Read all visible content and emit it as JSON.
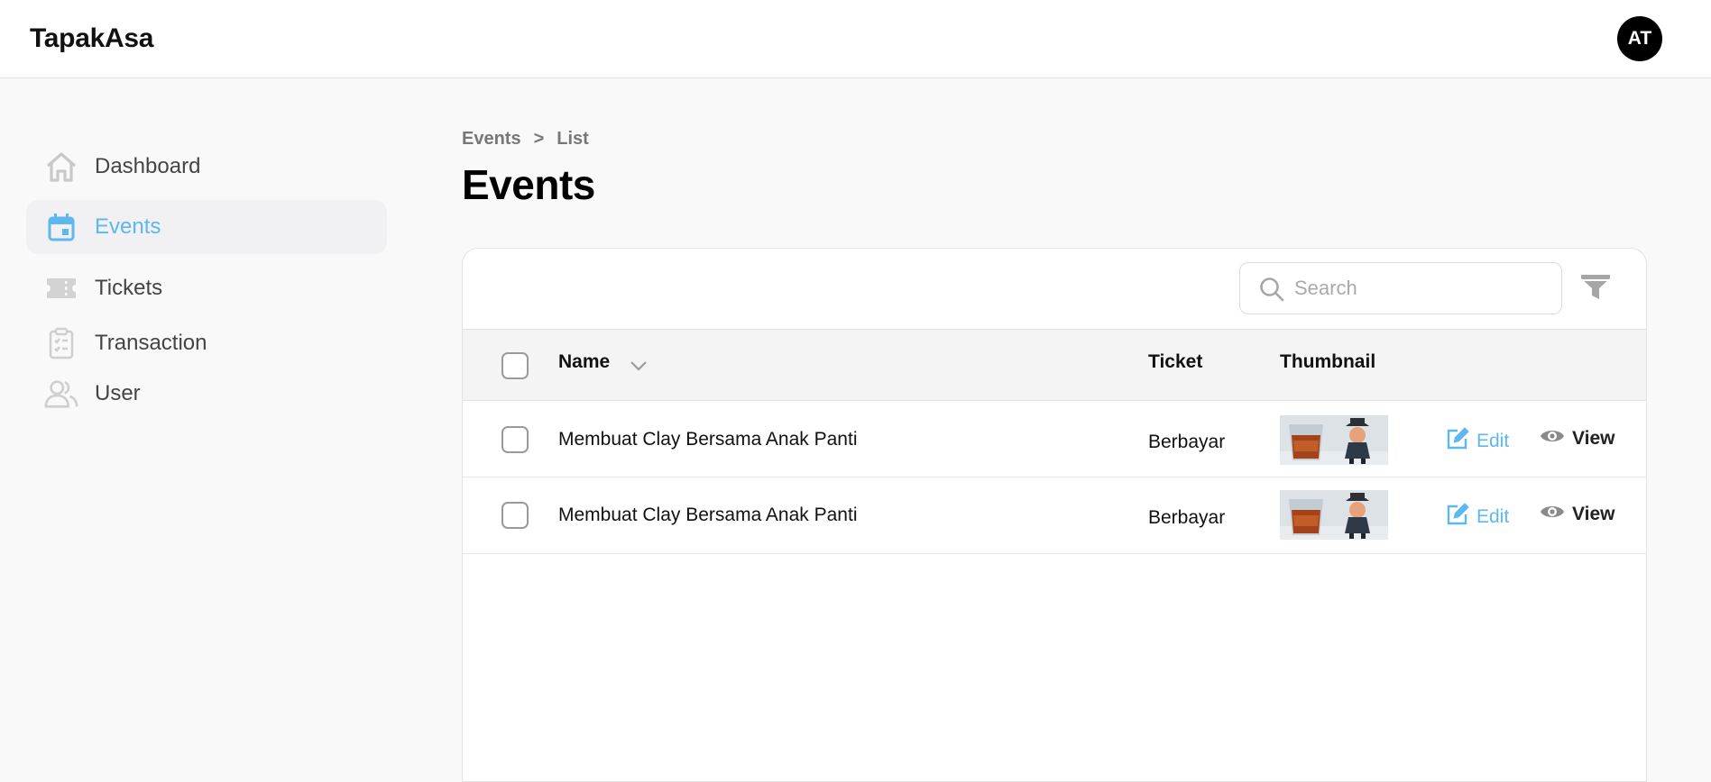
{
  "header": {
    "brand": "TapakAsa",
    "avatar_initials": "AT"
  },
  "sidebar": {
    "items": [
      {
        "label": "Dashboard",
        "icon": "home-icon",
        "active": false
      },
      {
        "label": "Events",
        "icon": "calendar-icon",
        "active": true
      },
      {
        "label": "Tickets",
        "icon": "ticket-icon",
        "active": false
      },
      {
        "label": "Transaction",
        "icon": "clipboard-icon",
        "active": false
      },
      {
        "label": "User",
        "icon": "users-icon",
        "active": false
      }
    ]
  },
  "breadcrumb": {
    "parent": "Events",
    "separator": ">",
    "current": "List"
  },
  "page": {
    "title": "Events"
  },
  "toolbar": {
    "search_placeholder": "Search",
    "search_value": ""
  },
  "table": {
    "columns": {
      "name": "Name",
      "ticket": "Ticket",
      "thumbnail": "Thumbnail"
    },
    "rows": [
      {
        "name": "Membuat Clay Bersama Anak Panti",
        "ticket": "Berbayar",
        "edit_label": "Edit",
        "view_label": "View"
      },
      {
        "name": "Membuat Clay Bersama Anak Panti",
        "ticket": "Berbayar",
        "edit_label": "Edit",
        "view_label": "View"
      }
    ]
  },
  "colors": {
    "accent": "#5cb8ef",
    "active_bg": "#f1f0f2",
    "icon_gray": "#c9c9c9"
  }
}
